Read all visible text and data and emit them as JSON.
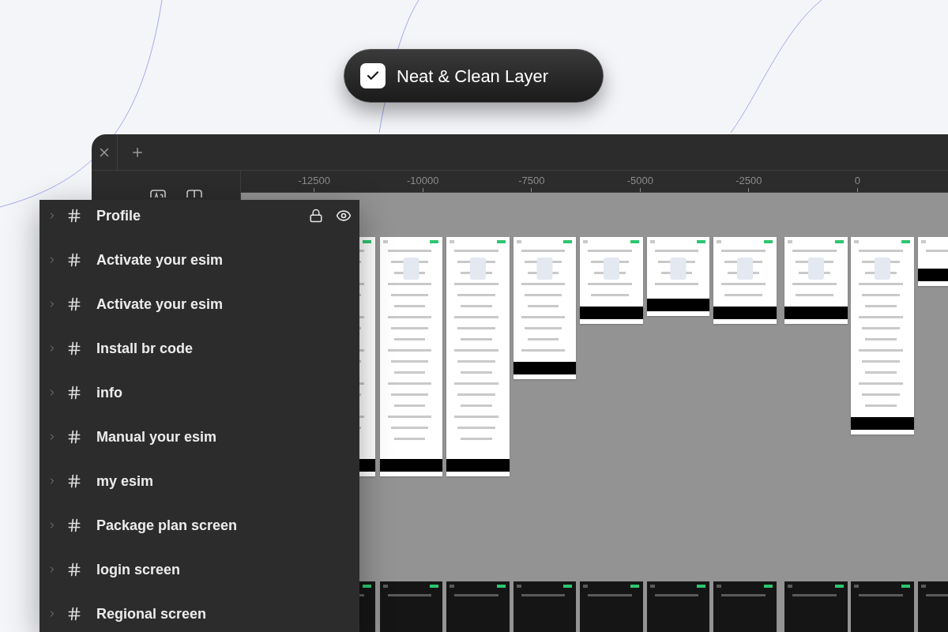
{
  "badge": {
    "label": "Neat & Clean Layer",
    "checked": true
  },
  "ruler": {
    "labels": [
      "-12500",
      "-10000",
      "-7500",
      "-5000",
      "-2500",
      "0"
    ]
  },
  "layers": [
    {
      "name": "Profile",
      "expanded": false,
      "hovered": true
    },
    {
      "name": "Activate your esim",
      "expanded": false,
      "hovered": false
    },
    {
      "name": "Activate your esim",
      "expanded": false,
      "hovered": false
    },
    {
      "name": "Install br code",
      "expanded": false,
      "hovered": false
    },
    {
      "name": "info",
      "expanded": false,
      "hovered": false
    },
    {
      "name": "Manual your esim",
      "expanded": false,
      "hovered": false
    },
    {
      "name": "my esim",
      "expanded": false,
      "hovered": false
    },
    {
      "name": "Package plan screen",
      "expanded": false,
      "hovered": false
    },
    {
      "name": "login screen",
      "expanded": false,
      "hovered": false
    },
    {
      "name": "Regional screen",
      "expanded": false,
      "hovered": false
    }
  ]
}
